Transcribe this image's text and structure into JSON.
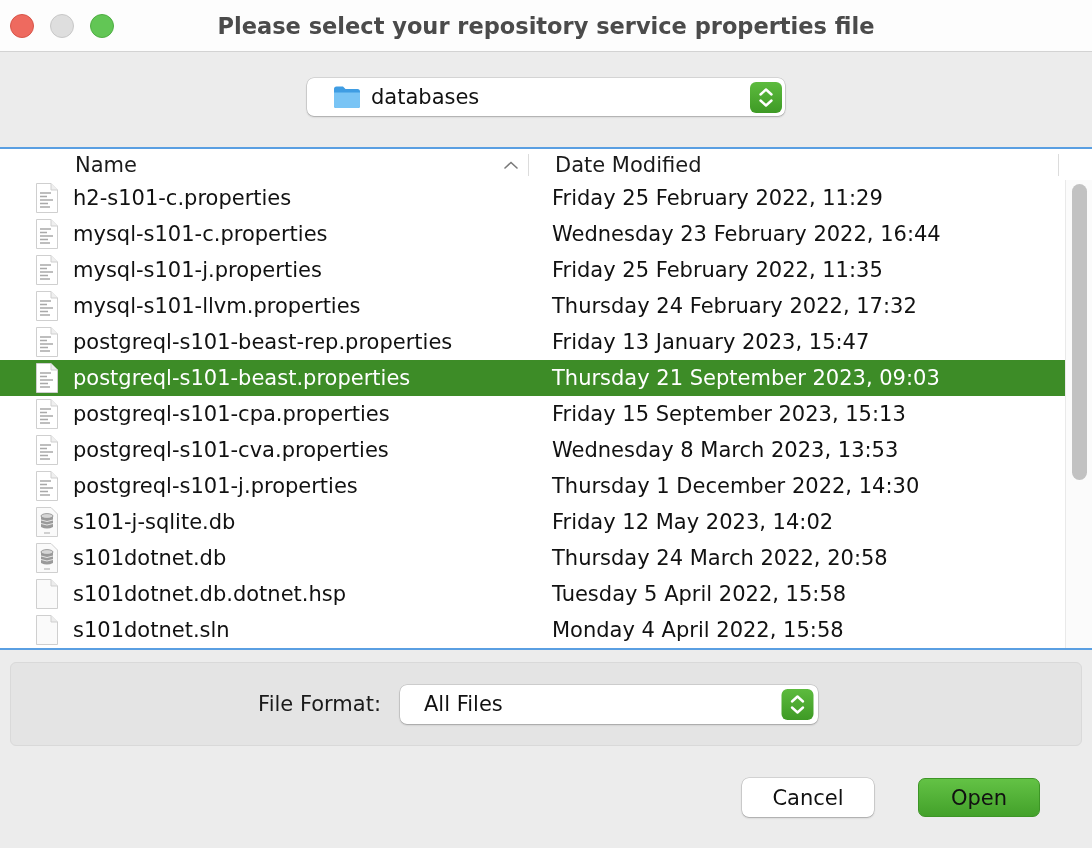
{
  "window": {
    "title": "Please select your repository service properties file",
    "controls": [
      {
        "kind": "close",
        "disabled": false
      },
      {
        "kind": "minimize",
        "disabled": true
      },
      {
        "kind": "zoom",
        "disabled": false
      }
    ]
  },
  "location": {
    "folder": "databases"
  },
  "table": {
    "columns": [
      {
        "label": "Name",
        "sorted": true
      },
      {
        "label": "Date Modified",
        "sorted": false
      }
    ],
    "rows": [
      {
        "name": "h2-s101-c.properties",
        "date": "Friday 25 February 2022, 11:29",
        "kind": "properties",
        "selected": false
      },
      {
        "name": "mysql-s101-c.properties",
        "date": "Wednesday 23 February 2022, 16:44",
        "kind": "properties",
        "selected": false
      },
      {
        "name": "mysql-s101-j.properties",
        "date": "Friday 25 February 2022, 11:35",
        "kind": "properties",
        "selected": false
      },
      {
        "name": "mysql-s101-llvm.properties",
        "date": "Thursday 24 February 2022, 17:32",
        "kind": "properties",
        "selected": false
      },
      {
        "name": "postgreql-s101-beast-rep.properties",
        "date": "Friday 13 January 2023, 15:47",
        "kind": "properties",
        "selected": false
      },
      {
        "name": "postgreql-s101-beast.properties",
        "date": "Thursday 21 September 2023, 09:03",
        "kind": "properties",
        "selected": true
      },
      {
        "name": "postgreql-s101-cpa.properties",
        "date": "Friday 15 September 2023, 15:13",
        "kind": "properties",
        "selected": false
      },
      {
        "name": "postgreql-s101-cva.properties",
        "date": "Wednesday 8 March 2023, 13:53",
        "kind": "properties",
        "selected": false
      },
      {
        "name": "postgreql-s101-j.properties",
        "date": "Thursday 1 December 2022, 14:30",
        "kind": "properties",
        "selected": false
      },
      {
        "name": "s101-j-sqlite.db",
        "date": "Friday 12 May 2023, 14:02",
        "kind": "database",
        "selected": false
      },
      {
        "name": "s101dotnet.db",
        "date": "Thursday 24 March 2022, 20:58",
        "kind": "database",
        "selected": false
      },
      {
        "name": "s101dotnet.db.dotnet.hsp",
        "date": "Tuesday 5 April 2022, 15:58",
        "kind": "file",
        "selected": false
      },
      {
        "name": "s101dotnet.sln",
        "date": "Monday 4 April 2022, 15:58",
        "kind": "file",
        "selected": false
      }
    ]
  },
  "file_format": {
    "label": "File Format:",
    "value": "All Files"
  },
  "buttons": [
    {
      "label": "Cancel",
      "kind": "cancel"
    },
    {
      "label": "Open",
      "kind": "confirm"
    }
  ]
}
